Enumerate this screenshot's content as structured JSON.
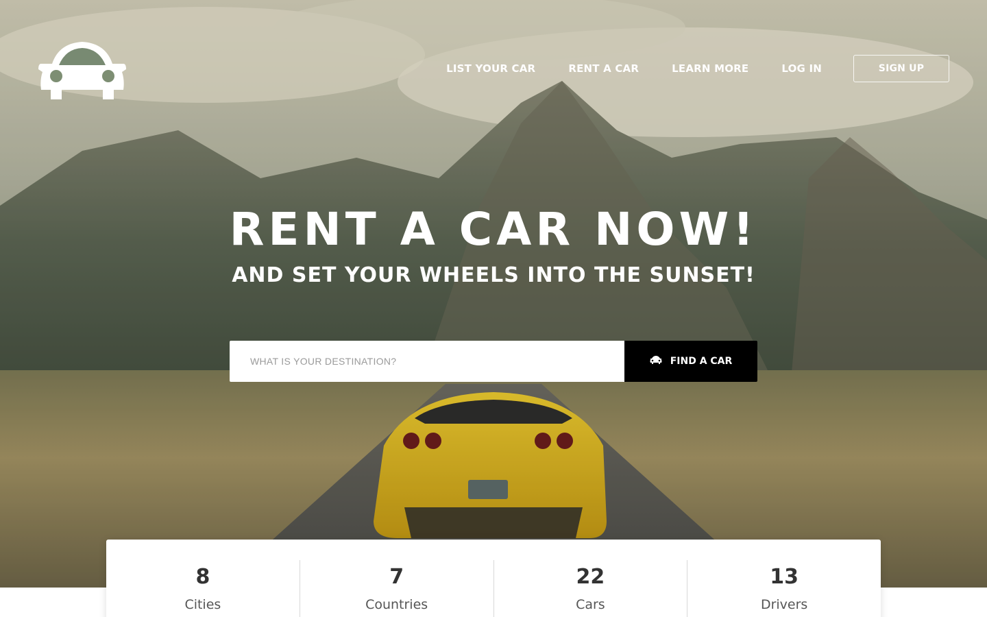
{
  "brand": {
    "logo_icon": "car-icon"
  },
  "nav": {
    "items": [
      {
        "label": "LIST YOUR CAR"
      },
      {
        "label": "RENT A CAR"
      },
      {
        "label": "LEARN MORE"
      },
      {
        "label": "LOG IN"
      }
    ],
    "signup_label": "SIGN UP"
  },
  "hero": {
    "title": "RENT A CAR NOW!",
    "subtitle": "AND SET YOUR WHEELS INTO THE SUNSET!"
  },
  "search": {
    "placeholder": "WHAT IS YOUR DESTINATION?",
    "value": "",
    "button_label": "FIND A CAR",
    "button_icon": "car-icon"
  },
  "stats": [
    {
      "value": "8",
      "label": "Cities"
    },
    {
      "value": "7",
      "label": "Countries"
    },
    {
      "value": "22",
      "label": "Cars"
    },
    {
      "value": "13",
      "label": "Drivers"
    }
  ],
  "colors": {
    "accent": "#000000",
    "car": "#e6b81c",
    "text_light": "#ffffff"
  }
}
